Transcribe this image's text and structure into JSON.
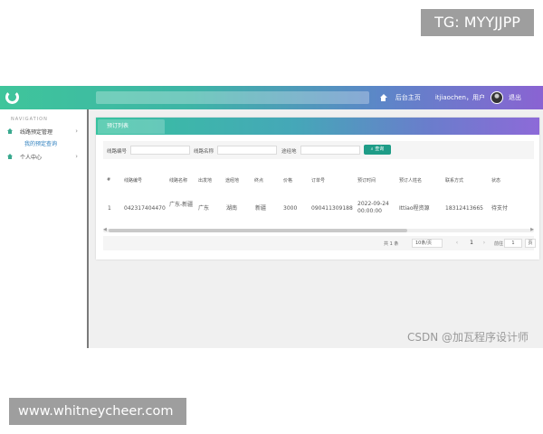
{
  "overlay": {
    "tg": "TG: MYYJJPP",
    "url": "www.whitneycheer.com",
    "watermark": "CSDN @加瓦程序设计师"
  },
  "header": {
    "home_link": "后台主页",
    "user": "itjiaochen，用户",
    "logout": "退出"
  },
  "sidebar": {
    "heading": "NAVIGATION",
    "items": [
      {
        "label": "线路预定管理",
        "sub": "我的预定查询"
      },
      {
        "label": "个人中心"
      }
    ]
  },
  "main": {
    "tab": "预订列表",
    "filters": {
      "route_no_label": "线路编号",
      "route_name_label": "线路名称",
      "dest_label": "途经地",
      "query_button": "查询"
    },
    "table": {
      "headers": [
        "#",
        "线路编号",
        "线路名称",
        "出发地",
        "途经地",
        "终点",
        "价格",
        "订单号",
        "预订时间",
        "预订人姓名",
        "联系方式",
        "状态"
      ],
      "rows": [
        [
          "1",
          "042317404470",
          "广东-新疆",
          "广东",
          "湖南",
          "新疆",
          "3000",
          "090411309188",
          "2022-09-24 00:00:00",
          "Ittiao程资源",
          "18312413665",
          "待支付"
        ]
      ]
    },
    "pager": {
      "total": "共 1 条",
      "page_size": "10条/页",
      "prev": "‹",
      "current": "1",
      "next": "›",
      "goto_label": "前往",
      "goto_value": "1",
      "page_suffix": "页"
    }
  },
  "colors": {
    "accent_start": "#3fc59b",
    "accent_end": "#8a63d2",
    "query_button": "#1e9c87"
  }
}
